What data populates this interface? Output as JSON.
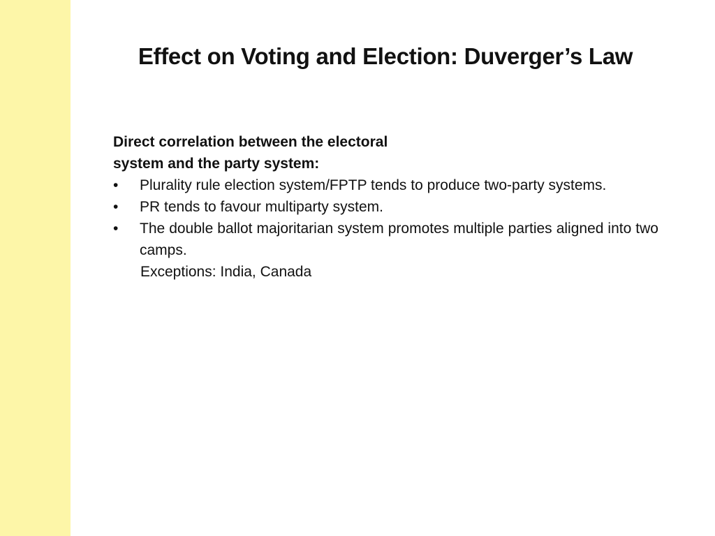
{
  "slide": {
    "title": "Effect on Voting and Election: Duverger’s Law",
    "lead": "Direct correlation between the electoral system and the party system:",
    "bullets": [
      "Plurality rule election system/FPTP tends to produce two-party systems.",
      "PR tends to favour multiparty system.",
      "The double ballot majoritarian system promotes multiple parties aligned into two camps."
    ],
    "bullet_glyph": "•",
    "note": "Exceptions: India, Canada",
    "accent_color": "#fdf6a8"
  }
}
